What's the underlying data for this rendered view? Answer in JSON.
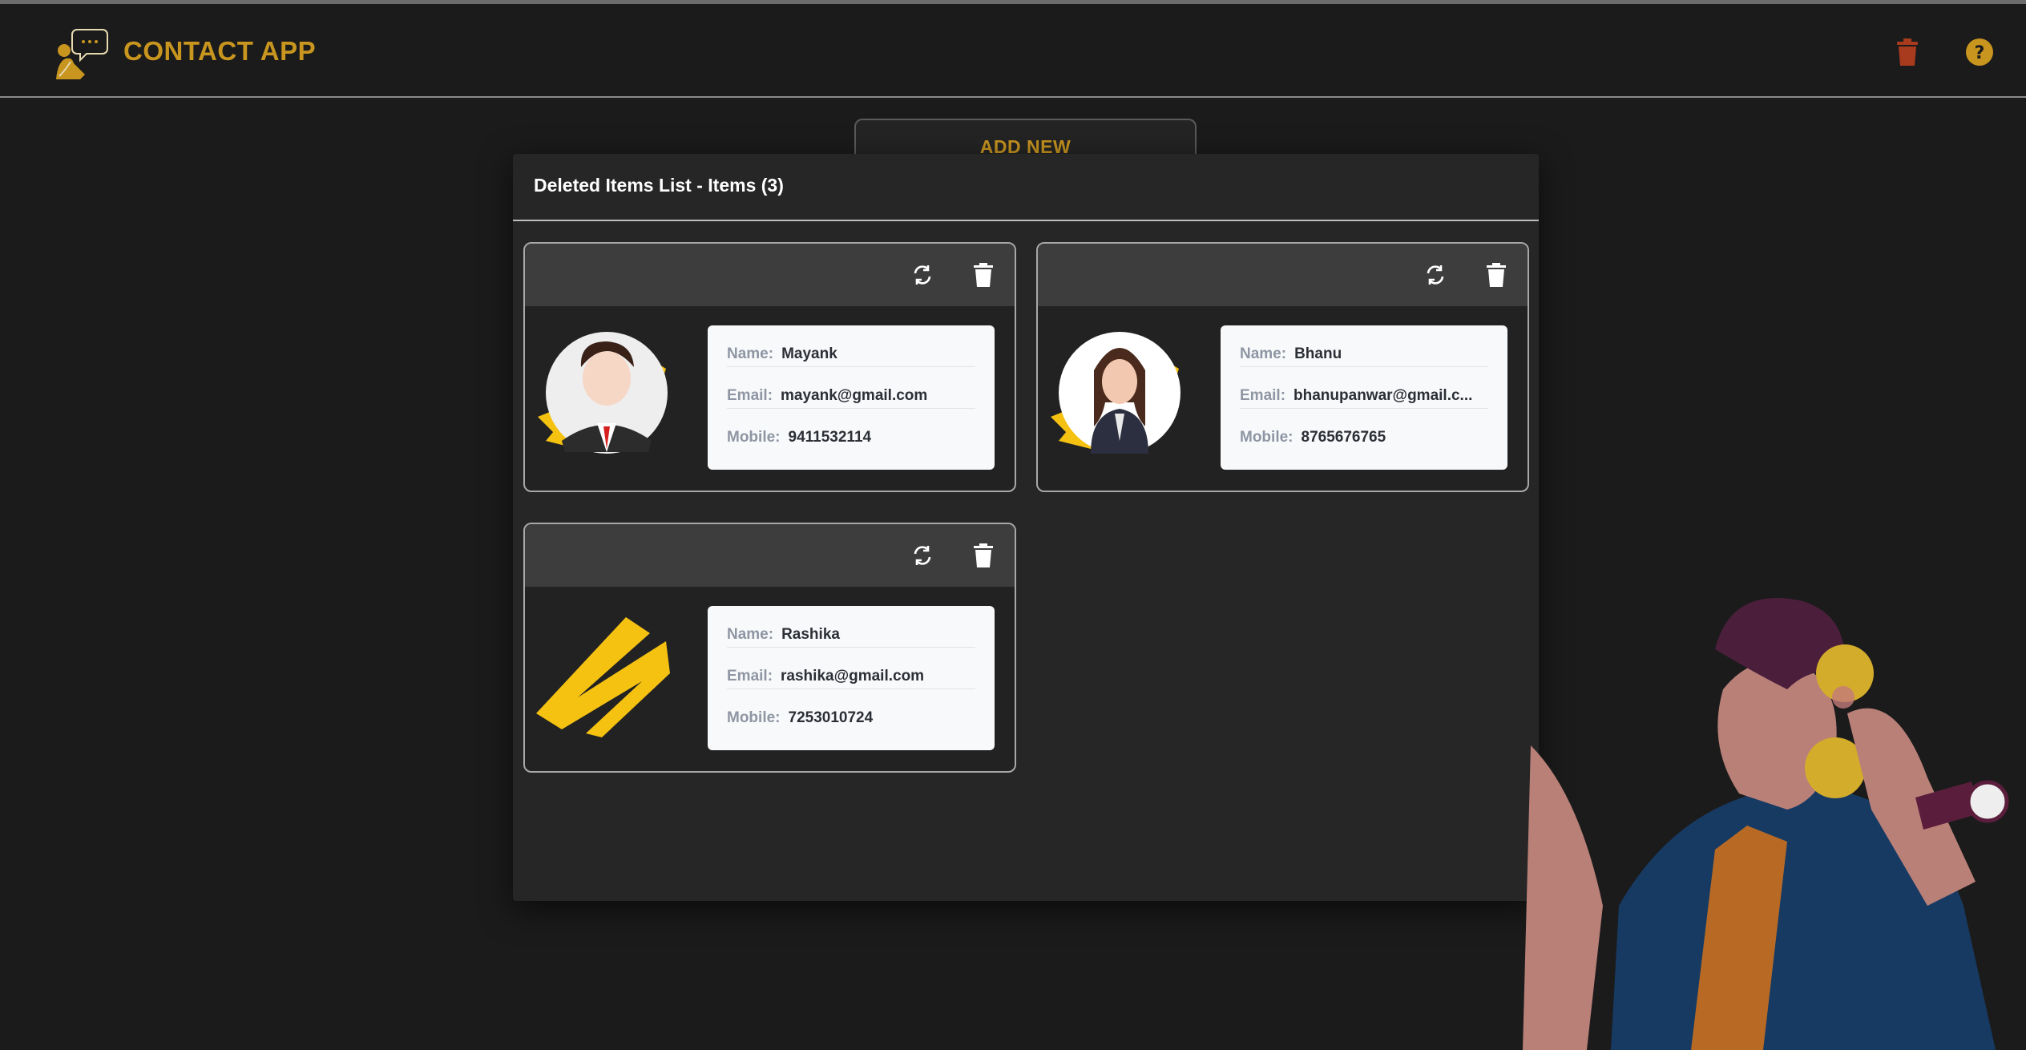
{
  "header": {
    "title": "CONTACT APP",
    "icons": {
      "logo": "contact-chat-logo-icon",
      "trash": "trash-icon",
      "help": "help-circle-icon"
    },
    "colors": {
      "accent": "#c8951f",
      "trash": "#a83a1e"
    }
  },
  "add_new": {
    "label": "ADD NEW"
  },
  "modal": {
    "title": "Deleted Items List - Items (3)",
    "labels": {
      "name": "Name:",
      "email": "Email:",
      "mobile": "Mobile:"
    },
    "items": [
      {
        "name": "Mayank",
        "email": "mayank@gmail.com",
        "mobile": "9411532114",
        "avatar": "male-avatar"
      },
      {
        "name": "Bhanu",
        "email": "bhanupanwar@gmail.c...",
        "mobile": "8765676765",
        "avatar": "female-avatar"
      },
      {
        "name": "Rashika",
        "email": "rashika@gmail.com",
        "mobile": "7253010724",
        "avatar": "none"
      }
    ],
    "icons": {
      "restore": "restore-icon",
      "delete": "delete-icon"
    }
  }
}
